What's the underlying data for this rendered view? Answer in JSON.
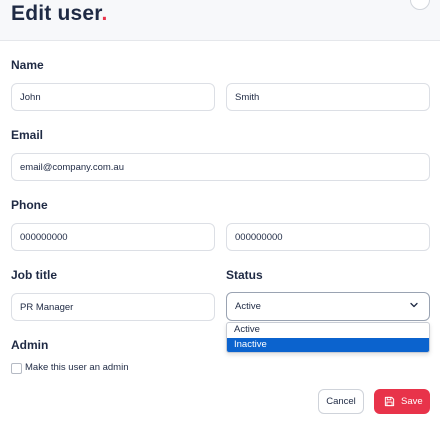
{
  "header": {
    "title": "Edit user",
    "title_dot": "."
  },
  "form": {
    "name_label": "Name",
    "first_name": "John",
    "last_name": "Smith",
    "email_label": "Email",
    "email": "email@company.com.au",
    "phone_label": "Phone",
    "phone_1": "000000000",
    "phone_2": "000000000",
    "job_title_label": "Job title",
    "job_title": "PR Manager",
    "status_label": "Status",
    "status_value": "Active",
    "status_options": [
      "Active",
      "Inactive"
    ],
    "admin_label": "Admin",
    "admin_checkbox_label": "Make this user an admin"
  },
  "actions": {
    "cancel": "Cancel",
    "save": "Save"
  },
  "colors": {
    "accent": "#e8334a",
    "selected_option": "#0b63ce"
  }
}
